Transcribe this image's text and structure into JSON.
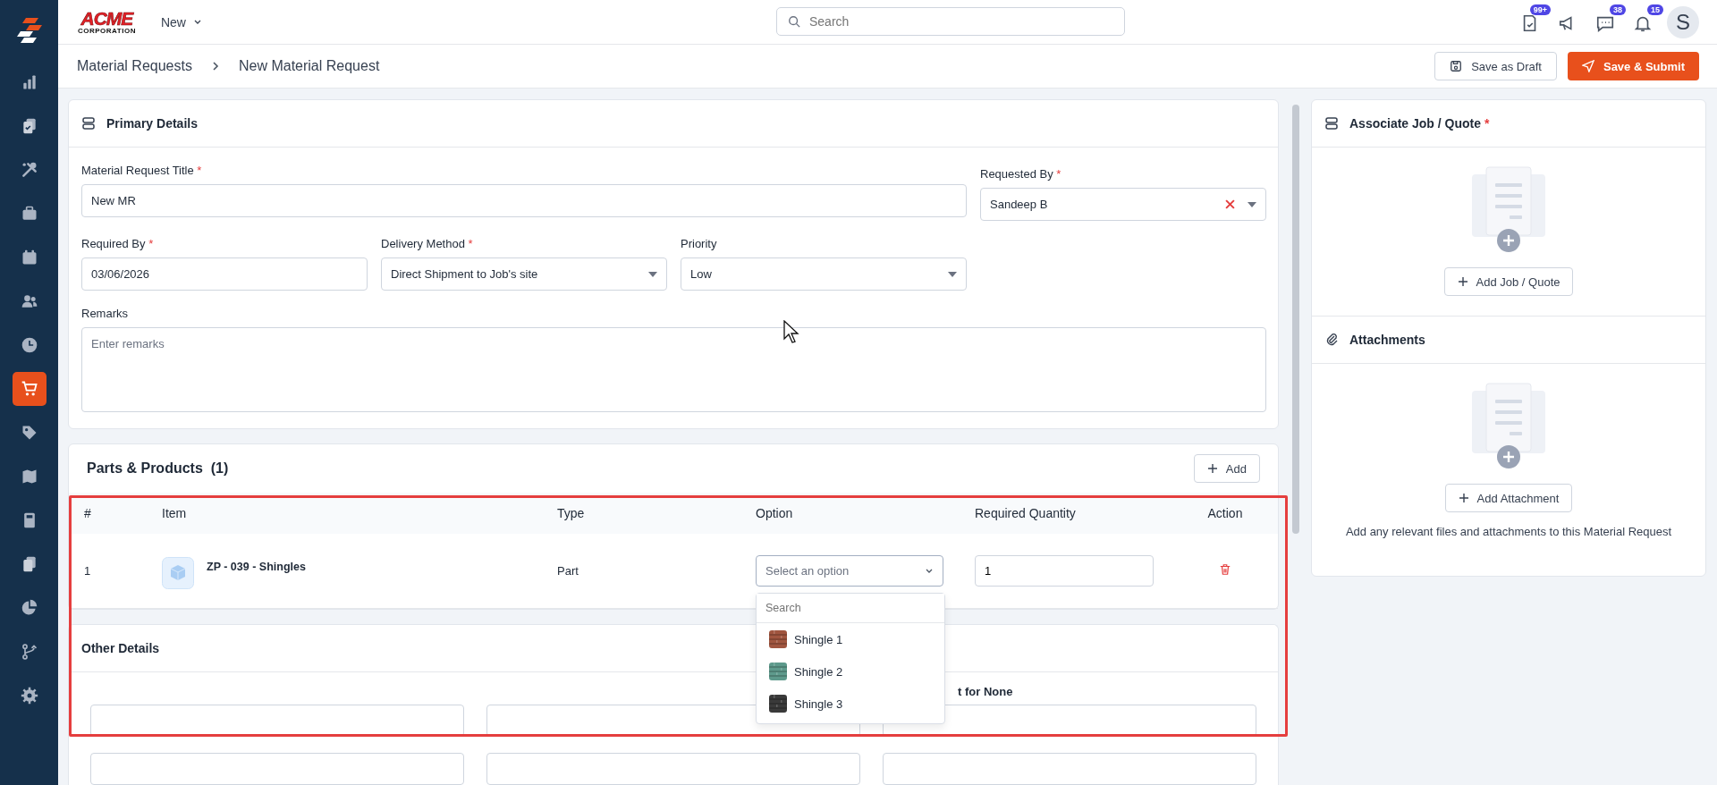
{
  "topbar": {
    "logo": {
      "wordmark": "ACME",
      "subline": "CORPORATION"
    },
    "new_menu": "New",
    "search": {
      "placeholder": "Search"
    },
    "notifications": [
      {
        "kind": "tasks",
        "badge": "99+"
      },
      {
        "kind": "announcements"
      },
      {
        "kind": "messages",
        "badge": "38"
      },
      {
        "kind": "alerts",
        "badge": "15"
      }
    ],
    "avatar": "S"
  },
  "sidebar": {
    "items": [
      {
        "kind": "analytics",
        "selected": false
      },
      {
        "kind": "clipboard",
        "selected": false
      },
      {
        "kind": "tools",
        "selected": false
      },
      {
        "kind": "briefcase",
        "selected": false
      },
      {
        "kind": "calendar",
        "selected": false
      },
      {
        "kind": "people",
        "selected": false
      },
      {
        "kind": "clock",
        "selected": false
      },
      {
        "kind": "cart",
        "selected": true
      },
      {
        "kind": "tag",
        "selected": false
      },
      {
        "kind": "map",
        "selected": false
      },
      {
        "kind": "calculator",
        "selected": false
      },
      {
        "kind": "documents",
        "selected": false
      },
      {
        "kind": "pie",
        "selected": false
      },
      {
        "kind": "branch",
        "selected": false
      },
      {
        "kind": "settings",
        "selected": false
      }
    ]
  },
  "breadcrumb": [
    "Material Requests",
    "New Material Request"
  ],
  "actions": {
    "draft": "Save as Draft",
    "submit": "Save & Submit"
  },
  "required_mark": "*",
  "primary_details": {
    "title": "Primary Details",
    "fields": [
      {
        "kind": "text",
        "label": "Material Request Title",
        "required": true,
        "value": "New MR"
      },
      {
        "kind": "select",
        "label": "Requested By",
        "required": true,
        "value": "Sandeep B",
        "clearable": true
      },
      {
        "kind": "text",
        "label": "Required By",
        "required": true,
        "value": "03/06/2026"
      },
      {
        "kind": "select",
        "label": "Delivery Method",
        "required": true,
        "value": "Direct Shipment to Job's site"
      },
      {
        "kind": "select",
        "label": "Priority",
        "required": false,
        "value": "Low"
      },
      {
        "kind": "textarea",
        "label": "Remarks",
        "required": false,
        "placeholder": "Enter remarks"
      }
    ]
  },
  "parts": {
    "title": "Parts & Products",
    "count": "(1)",
    "add_button": "Add",
    "highlighted": true,
    "columns": [
      "#",
      "Item",
      "Type",
      "Option",
      "Required Quantity",
      "Action"
    ],
    "rows": [
      {
        "index": "1",
        "item": "ZP - 039 - Shingles",
        "type": "Part",
        "option": {
          "placeholder": "Select an option",
          "open": true,
          "search_placeholder": "Search",
          "choices": [
            {
              "label": "Shingle 1",
              "color": "#a0553f"
            },
            {
              "label": "Shingle 2",
              "color": "#5e9a8c"
            },
            {
              "label": "Shingle 3",
              "color": "#3a3a3a"
            }
          ]
        },
        "quantity": "1"
      }
    ]
  },
  "other_details": {
    "title": "Other Details",
    "visible_label": "t for None"
  },
  "associate": {
    "title": "Associate Job / Quote",
    "required": true,
    "button": "Add Job / Quote"
  },
  "attachments": {
    "title": "Attachments",
    "button": "Add Attachment",
    "hint": "Add any relevant files and attachments to this Material Request"
  }
}
